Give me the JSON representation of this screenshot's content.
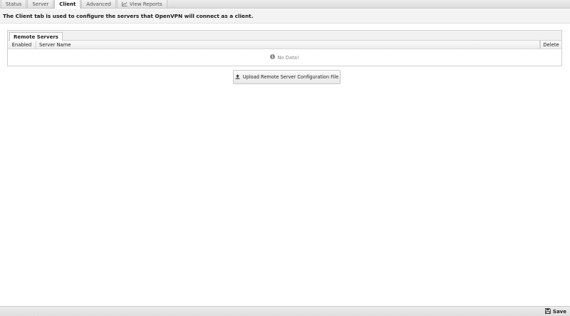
{
  "tabs": [
    {
      "label": "Status",
      "active": false
    },
    {
      "label": "Server",
      "active": false
    },
    {
      "label": "Client",
      "active": true
    },
    {
      "label": "Advanced",
      "active": false
    },
    {
      "label": "View Reports",
      "active": false,
      "icon": "chart-icon"
    }
  ],
  "description": "The Client tab is used to configure the servers that OpenVPN will connect as a client.",
  "grid": {
    "tab_label": "Remote Servers",
    "columns": {
      "enabled": "Enabled",
      "server_name": "Server Name",
      "delete": "Delete"
    },
    "empty_text": "No Data!",
    "empty_icon": "info-circle-icon"
  },
  "upload_button": {
    "label": "Upload Remote Server Configuration File",
    "icon": "upload-icon"
  },
  "save_button": {
    "label": "Save",
    "icon": "floppy-disk-icon"
  }
}
